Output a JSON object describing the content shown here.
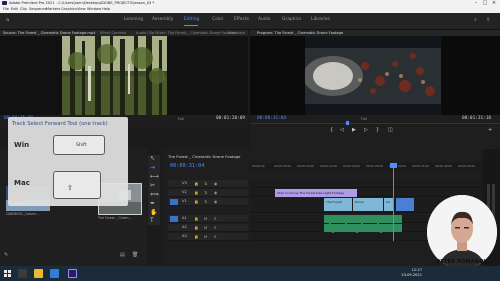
{
  "window": {
    "title": "Adobe Premiere Pro 2021 - C:\\Users\\barn\\Desktop\\ADOBE_PROJECTS\\lesson_03 *"
  },
  "menu": [
    "File",
    "Edit",
    "Clip",
    "Sequence",
    "Markers",
    "Graphics",
    "View",
    "Window",
    "Help"
  ],
  "workspaces": {
    "items": [
      "Learning",
      "Assembly",
      "Editing",
      "Color",
      "Effects",
      "Audio",
      "Graphics",
      "Libraries"
    ],
    "active": "Editing"
  },
  "source_panel": {
    "tabs": [
      "Source: The Forest _ Cinematic Drone Footage.mp4",
      "Effect Controls",
      "Audio Clip Mixer: The Forest _ Cinematic Drone Footage",
      "Metadata"
    ],
    "timecode": "00:00:15:00",
    "zoom": "Full",
    "duration": "00:01:20:09"
  },
  "program_panel": {
    "tabs": [
      "Program: The Forest _ Cinematic Drone Footage"
    ],
    "timecode": "00:00:31:04",
    "zoom": "Full",
    "duration": "00:01:31:10"
  },
  "tooltip": {
    "title": "Track Select Forward Tool (one track)",
    "win_label": "Win",
    "win_key": "Shift",
    "mac_label": "Mac",
    "mac_key": "⇧"
  },
  "project_panel": {
    "items": [
      "CINEMATIC_Colorin...",
      "The Forest _ Cinem..."
    ]
  },
  "timeline": {
    "tab": "The Forest _ Cinematic Drone Footage",
    "timecode": "00:00:31:04",
    "ruler": [
      "00:00:00",
      "00:00:05:00",
      "00:00:10:00",
      "00:00:15:00",
      "00:00:20:00",
      "00:00:25:00",
      "00:00:30:00",
      "00:00:35:00",
      "00:00:40:00",
      "00:00:45:00"
    ],
    "tracks": [
      "V3",
      "V2",
      "V1",
      "A1",
      "A2",
      "A3"
    ],
    "clips": {
      "text": "Shot on Drone The Forest bike night Footage",
      "v1a": "The Forest",
      "v1b": "Drone",
      "v1c": "Ins"
    }
  },
  "webcam": {
    "name": "PETER ROMANOV",
    "role": "VIDEO CREATOR"
  },
  "taskbar": {
    "time": "12:27",
    "date": "23.09.2021"
  },
  "colors": {
    "accent": "#4f8cff",
    "clip_video": "#7fb7d6",
    "clip_audio": "#2f8f5e",
    "clip_text": "#b19ae8"
  }
}
